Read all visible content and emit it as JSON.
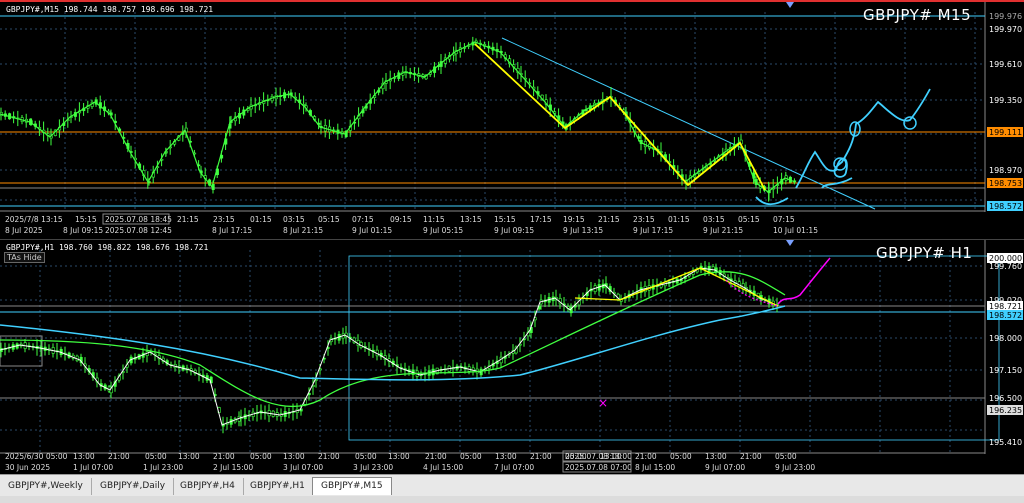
{
  "m15": {
    "info": "GBPJPY#,M15  198.744 198.757 198.696 198.721",
    "title": "GBPJPY# M15",
    "price_labels": [
      "199.976",
      "199.970",
      "199.610",
      "199.350",
      "199.111",
      "198.970",
      "198.753",
      "198.572"
    ],
    "time_labels": [
      "2025/7/8 13:15",
      "15:15",
      "2025.07.08 18:45",
      "21:15",
      "23:15",
      "01:15",
      "03:15",
      "05:15",
      "07:15",
      "09:15",
      "11:15",
      "13:15",
      "15:15",
      "17:15",
      "19:15",
      "21:15",
      "23:15",
      "01:15",
      "03:15",
      "05:15",
      "07:15"
    ],
    "date_labels": [
      "8 Jul 2025",
      "8 Jul 09:15",
      "2025.07.08 12:45",
      "8 Jul 17:15",
      "8 Jul 21:15",
      "9 Jul 01:15",
      "9 Jul 05:15",
      "9 Jul 09:15",
      "9 Jul 13:15",
      "9 Jul 17:15",
      "9 Jul 21:15",
      "10 Jul 01:15"
    ]
  },
  "h1": {
    "info": "GBPJPY#,H1  198.760 198.822 198.676 198.721",
    "title": "GBPJPY# H1",
    "badge": "TAs Hide",
    "price_labels": [
      "200.000",
      "199.760",
      "199.020",
      "198.721",
      "198.572",
      "198.000",
      "197.150",
      "196.500",
      "196.235",
      "195.410"
    ],
    "time_labels": [
      "2025/6/30 05:00",
      "13:00",
      "21:00",
      "05:00",
      "13:00",
      "21:00",
      "05:00",
      "13:00",
      "21:00",
      "05:00",
      "13:00",
      "21:00",
      "05:00",
      "13:00",
      "21:00",
      "05:00",
      "13:00",
      "21:00",
      "2025.07.08 13:00",
      "05:00",
      "13:00",
      "21:00",
      "05:00"
    ],
    "date_labels": [
      "30 Jun 2025",
      "1 Jul 07:00",
      "1 Jul 23:00",
      "2 Jul 15:00",
      "3 Jul 07:00",
      "3 Jul 23:00",
      "4 Jul 15:00",
      "7 Jul 07:00",
      "2025.07.08 07:00",
      "8 Jul 15:00",
      "9 Jul 07:00",
      "9 Jul 23:00"
    ]
  },
  "tabs": [
    "GBPJPY#,Weekly",
    "GBPJPY#,Daily",
    "GBPJPY#,H4",
    "GBPJPY#,H1",
    "GBPJPY#,M15"
  ],
  "active_tab": "GBPJPY#,M15",
  "colors": {
    "green": "#40ff40",
    "yellow": "#ffff00",
    "cyan": "#40d0ff",
    "orange": "#ff8c00",
    "magenta": "#ff00ff",
    "white": "#ffffff"
  }
}
